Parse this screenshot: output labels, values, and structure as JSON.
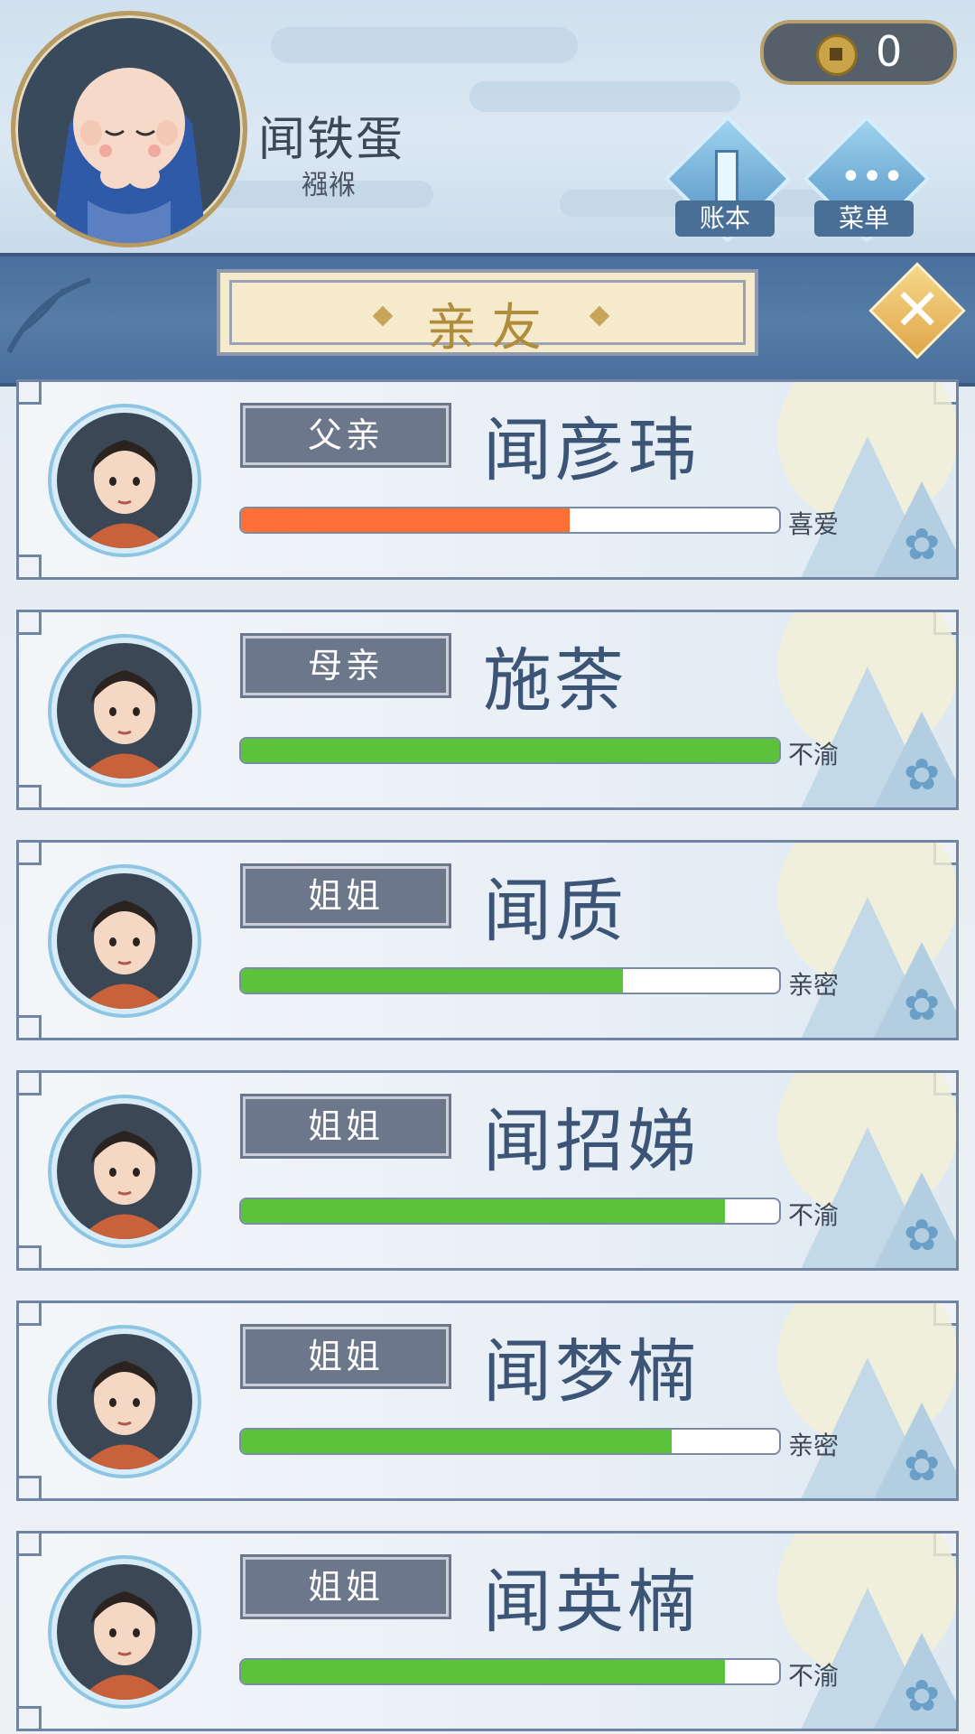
{
  "header": {
    "player_name": "闻铁蛋",
    "player_age": "襁褓",
    "coins": "0",
    "ledger_label": "账本",
    "menu_label": "菜单"
  },
  "banner": {
    "title": "亲友",
    "close_symbol": "✕"
  },
  "relatives": [
    {
      "relation": "父亲",
      "name": "闻彦玮",
      "mood": "喜爱",
      "affinity": 0.61,
      "bar_color": "#ff6e35"
    },
    {
      "relation": "母亲",
      "name": "施荼",
      "mood": "不渝",
      "affinity": 1.0,
      "bar_color": "#5ac23b"
    },
    {
      "relation": "姐姐",
      "name": "闻质",
      "mood": "亲密",
      "affinity": 0.71,
      "bar_color": "#5ac23b"
    },
    {
      "relation": "姐姐",
      "name": "闻招娣",
      "mood": "不渝",
      "affinity": 0.9,
      "bar_color": "#5ac23b"
    },
    {
      "relation": "姐姐",
      "name": "闻梦楠",
      "mood": "亲密",
      "affinity": 0.8,
      "bar_color": "#5ac23b"
    },
    {
      "relation": "姐姐",
      "name": "闻英楠",
      "mood": "不渝",
      "affinity": 0.9,
      "bar_color": "#5ac23b"
    }
  ]
}
